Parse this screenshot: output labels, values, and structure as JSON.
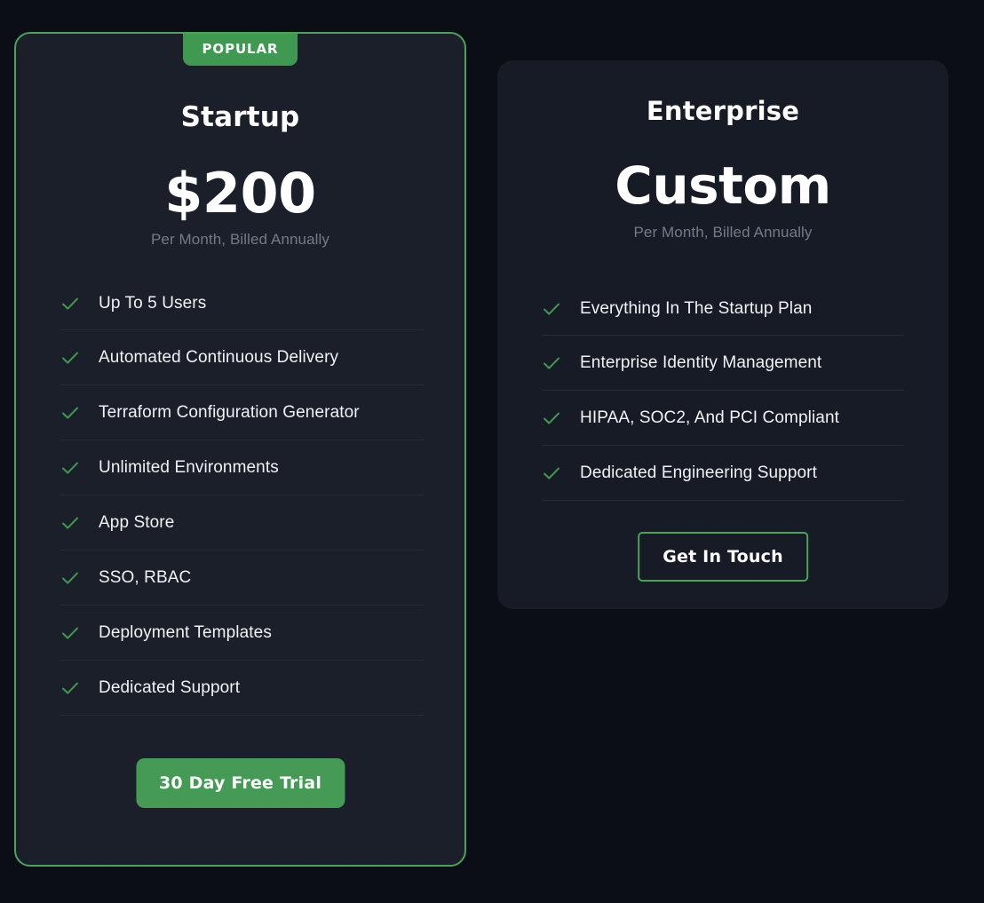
{
  "theme": {
    "page_background": "#0c0e16",
    "accent_green": "#4aa25b",
    "badge_green": "#3f9950",
    "button_green": "#459b55",
    "card_featured_background": "#1b1f29",
    "card_background": "#171b25",
    "divider_color": "#262b36",
    "text_primary": "#ffffff",
    "text_muted": "#737a88"
  },
  "plans": [
    {
      "id": "startup",
      "badge": "POPULAR",
      "name": "Startup",
      "price": "$200",
      "period": "Per Month, Billed Annually",
      "features": [
        "Up To 5 Users",
        "Automated Continuous Delivery",
        "Terraform Configuration Generator",
        "Unlimited Environments",
        "App Store",
        "SSO, RBAC",
        "Deployment Templates",
        "Dedicated Support"
      ],
      "cta_label": "30 Day Free Trial",
      "check_icon": "check-icon"
    },
    {
      "id": "enterprise",
      "name": "Enterprise",
      "price": "Custom",
      "period": "Per Month, Billed Annually",
      "features": [
        "Everything In The Startup Plan",
        "Enterprise Identity Management",
        "HIPAA, SOC2, And PCI Compliant",
        "Dedicated Engineering Support"
      ],
      "cta_label": "Get In Touch",
      "check_icon": "check-icon"
    }
  ]
}
